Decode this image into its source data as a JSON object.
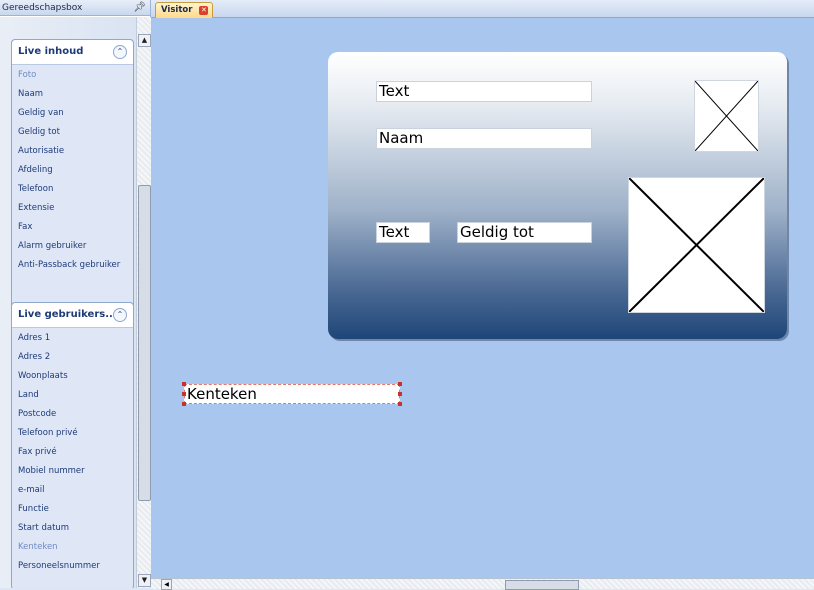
{
  "toolbox": {
    "title": "Gereedschapsbox",
    "pin_icon": "pin-icon",
    "groups": [
      {
        "title": "Live inhoud",
        "items": [
          {
            "label": "Foto",
            "dim": true
          },
          {
            "label": "Naam"
          },
          {
            "label": "Geldig van"
          },
          {
            "label": "Geldig tot"
          },
          {
            "label": "Autorisatie"
          },
          {
            "label": "Afdeling"
          },
          {
            "label": "Telefoon"
          },
          {
            "label": "Extensie"
          },
          {
            "label": "Fax"
          },
          {
            "label": "Alarm gebruiker"
          },
          {
            "label": "Anti-Passback gebruiker"
          }
        ]
      },
      {
        "title": "Live gebruikers...",
        "items": [
          {
            "label": "Adres 1"
          },
          {
            "label": "Adres 2"
          },
          {
            "label": "Woonplaats"
          },
          {
            "label": "Land"
          },
          {
            "label": "Postcode"
          },
          {
            "label": "Telefoon privé"
          },
          {
            "label": "Fax privé"
          },
          {
            "label": "Mobiel nummer"
          },
          {
            "label": "e-mail"
          },
          {
            "label": "Functie"
          },
          {
            "label": "Start datum"
          },
          {
            "label": "Kenteken",
            "dim": true
          },
          {
            "label": "Personeelsnummer"
          }
        ]
      }
    ]
  },
  "document": {
    "tab_label": "Visitor",
    "card": {
      "fields": [
        "Text",
        "Naam",
        "Text",
        "Geldig tot"
      ]
    },
    "selected_field": "Kenteken"
  },
  "colors": {
    "canvas": "#a9c6ef",
    "card_top": "#ffffff",
    "card_bottom": "#1e4679",
    "tab_active": "#ffd98a",
    "selection_handle": "#c8322d"
  }
}
